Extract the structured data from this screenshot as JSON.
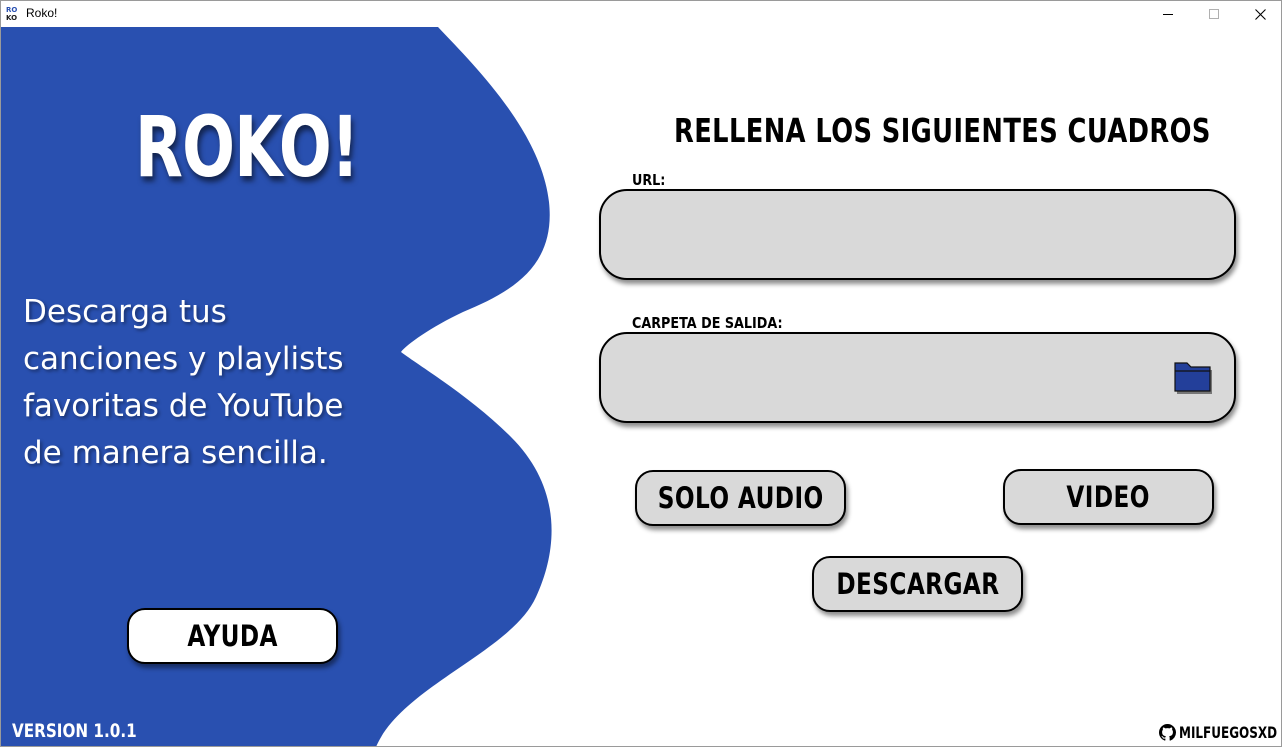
{
  "window": {
    "title": "Roko!",
    "app_icon_text": "ROKO"
  },
  "colors": {
    "brand_blue": "#2950b0",
    "field_gray": "#d9d9d9",
    "folder_blue": "#233f9a"
  },
  "sidebar": {
    "logo": "ROKO!",
    "tagline": "Descarga tus canciones y playlists favoritas de YouTube de manera sencilla.",
    "help_button": "AYUDA",
    "version": "VERSION 1.0.1"
  },
  "form": {
    "title": "RELLENA LOS SIGUIENTES CUADROS",
    "url_label": "URL:",
    "url_value": "",
    "output_label": "CARPETA DE SALIDA:",
    "output_value": "",
    "folder_icon": "folder-icon",
    "audio_button": "SOLO AUDIO",
    "video_button": "VIDEO",
    "download_button": "DESCARGAR"
  },
  "footer": {
    "credit_icon": "github-icon",
    "credit": "MILFUEGOSXD"
  }
}
